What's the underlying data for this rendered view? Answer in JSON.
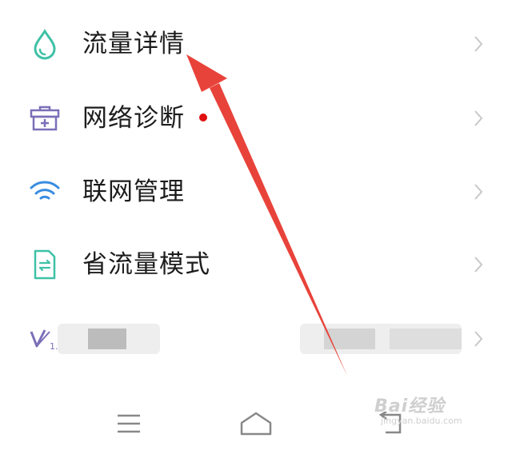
{
  "menu": {
    "items": [
      {
        "label": "流量详情",
        "icon": "water-drop-icon"
      },
      {
        "label": "网络诊断",
        "icon": "toolbox-icon",
        "badge": "red-dot"
      },
      {
        "label": "联网管理",
        "icon": "wifi-icon"
      },
      {
        "label": "省流量模式",
        "icon": "document-swap-icon"
      }
    ],
    "partial_item_icon": "v-logo-icon"
  },
  "navbar": {
    "buttons": [
      "menu-icon",
      "home-icon",
      "back-icon"
    ]
  },
  "watermark": {
    "main": "Bai经验",
    "sub": "jingyan.baidu.com"
  },
  "colors": {
    "teal": "#3ec1a6",
    "purple": "#7b6fb8",
    "blue": "#3a8de0",
    "annotation_red": "#e8433a"
  }
}
